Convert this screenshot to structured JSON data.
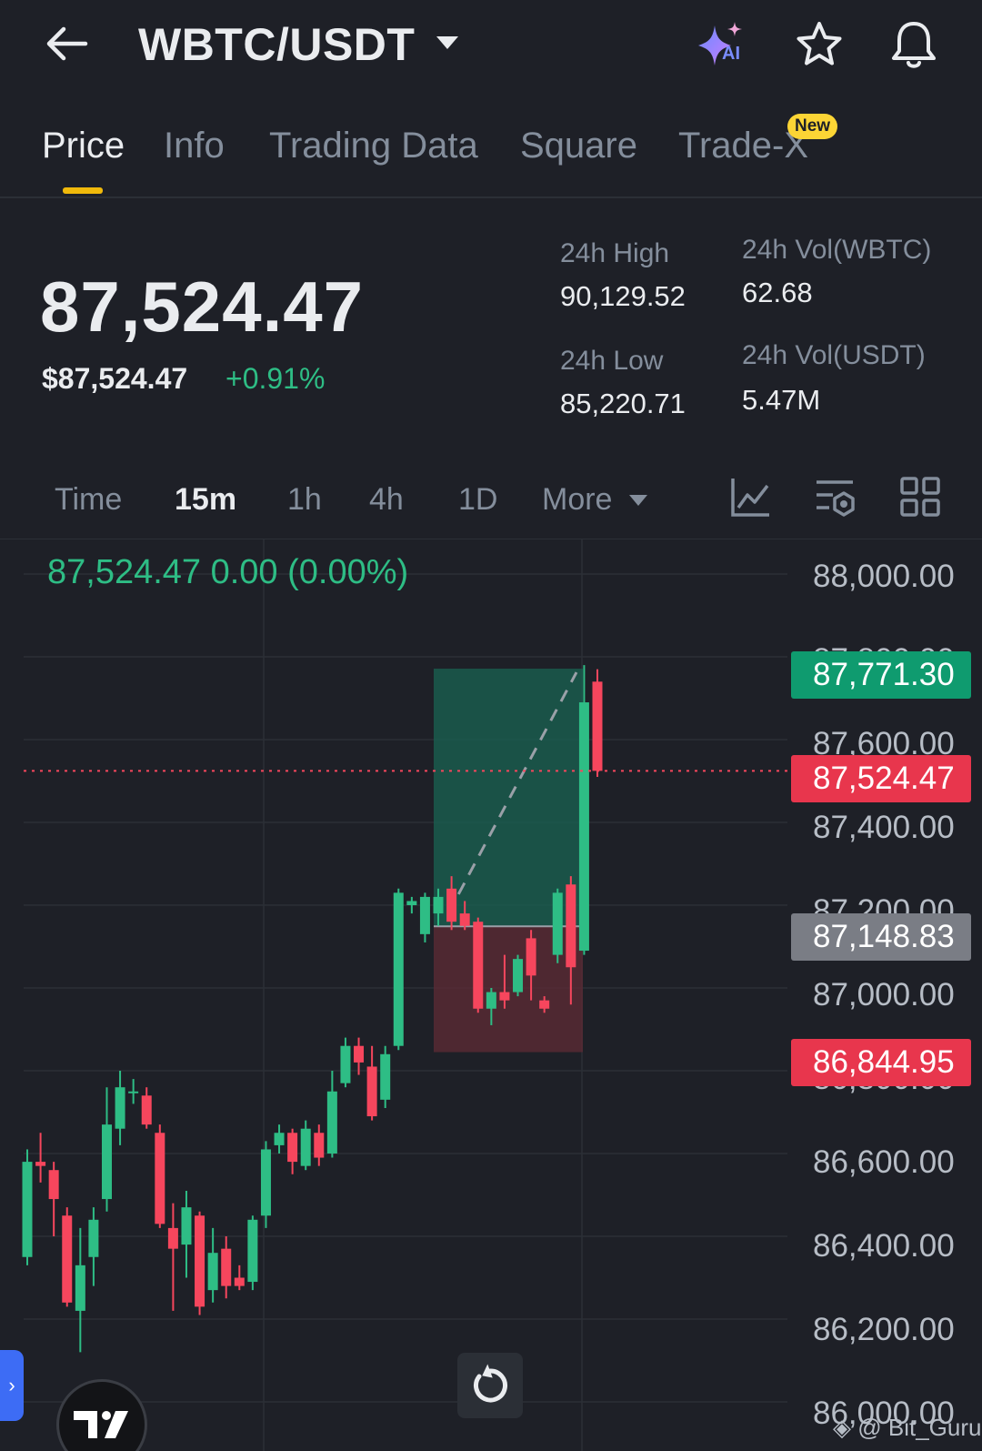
{
  "header": {
    "pair": "WBTC/USDT",
    "icons": [
      "back-arrow-icon",
      "caret-down-icon",
      "ai-sparkle-icon",
      "star-icon",
      "bell-icon"
    ],
    "ai_badge": "AI"
  },
  "tabs": [
    {
      "label": "Price",
      "active": true
    },
    {
      "label": "Info",
      "active": false
    },
    {
      "label": "Trading Data",
      "active": false
    },
    {
      "label": "Square",
      "active": false
    },
    {
      "label": "Trade-X",
      "active": false
    }
  ],
  "new_badge": "New",
  "ticker": {
    "last_price": "87,524.47",
    "usd_price": "$87,524.47",
    "change_pct": "+0.91%",
    "high_label": "24h High",
    "high_value": "90,129.52",
    "low_label": "24h Low",
    "low_value": "85,220.71",
    "vol_base_label": "24h Vol(WBTC)",
    "vol_base_value": "62.68",
    "vol_quote_label": "24h Vol(USDT)",
    "vol_quote_value": "5.47M"
  },
  "intervals": [
    {
      "label": "Time",
      "active": false
    },
    {
      "label": "15m",
      "active": true
    },
    {
      "label": "1h",
      "active": false
    },
    {
      "label": "4h",
      "active": false
    },
    {
      "label": "1D",
      "active": false
    },
    {
      "label": "More",
      "active": false
    }
  ],
  "tool_icons": [
    "indicator-chart-icon",
    "chart-settings-icon",
    "grid-layout-icon"
  ],
  "chart": {
    "ohlc_line": "87,524.47  0.00 (0.00%)",
    "y_axis_labels": [
      "88,000.00",
      "87,800.00",
      "87,600.00",
      "87,400.00",
      "87,200.00",
      "87,000.00",
      "86,800.00",
      "86,600.00",
      "86,400.00",
      "86,200.00",
      "86,000.00"
    ],
    "tag_high": "87,771.30",
    "tag_last": "87,524.47",
    "tag_entry": "87,148.83",
    "tag_stop": "86,844.95",
    "colors": {
      "up": "#2ebd85",
      "down": "#f6465d",
      "tag_green": "#0f9b6f",
      "tag_red": "#e8364d",
      "tag_gray": "#7a7d85"
    }
  },
  "chart_data": {
    "type": "candlestick",
    "interval": "15m",
    "ylim": [
      86000,
      88000
    ],
    "y_ticks": [
      86000,
      86200,
      86400,
      86600,
      86800,
      87000,
      87200,
      87400,
      87600,
      87800,
      88000
    ],
    "candles": [
      {
        "o": 86350,
        "h": 86610,
        "l": 86330,
        "c": 86580
      },
      {
        "o": 86580,
        "h": 86650,
        "l": 86530,
        "c": 86570
      },
      {
        "o": 86560,
        "h": 86580,
        "l": 86400,
        "c": 86490
      },
      {
        "o": 86450,
        "h": 86470,
        "l": 86230,
        "c": 86240
      },
      {
        "o": 86220,
        "h": 86420,
        "l": 86120,
        "c": 86330
      },
      {
        "o": 86350,
        "h": 86470,
        "l": 86280,
        "c": 86440
      },
      {
        "o": 86490,
        "h": 86760,
        "l": 86460,
        "c": 86670
      },
      {
        "o": 86660,
        "h": 86800,
        "l": 86620,
        "c": 86760
      },
      {
        "o": 86750,
        "h": 86780,
        "l": 86720,
        "c": 86750
      },
      {
        "o": 86740,
        "h": 86760,
        "l": 86660,
        "c": 86670
      },
      {
        "o": 86650,
        "h": 86670,
        "l": 86420,
        "c": 86430
      },
      {
        "o": 86420,
        "h": 86480,
        "l": 86220,
        "c": 86370
      },
      {
        "o": 86380,
        "h": 86510,
        "l": 86300,
        "c": 86470
      },
      {
        "o": 86450,
        "h": 86460,
        "l": 86210,
        "c": 86230
      },
      {
        "o": 86270,
        "h": 86420,
        "l": 86240,
        "c": 86360
      },
      {
        "o": 86370,
        "h": 86400,
        "l": 86250,
        "c": 86280
      },
      {
        "o": 86300,
        "h": 86330,
        "l": 86270,
        "c": 86280
      },
      {
        "o": 86290,
        "h": 86450,
        "l": 86270,
        "c": 86440
      },
      {
        "o": 86450,
        "h": 86630,
        "l": 86420,
        "c": 86610
      },
      {
        "o": 86620,
        "h": 86670,
        "l": 86600,
        "c": 86650
      },
      {
        "o": 86650,
        "h": 86660,
        "l": 86550,
        "c": 86580
      },
      {
        "o": 86570,
        "h": 86680,
        "l": 86560,
        "c": 86660
      },
      {
        "o": 86650,
        "h": 86670,
        "l": 86570,
        "c": 86590
      },
      {
        "o": 86600,
        "h": 86800,
        "l": 86590,
        "c": 86750
      },
      {
        "o": 86770,
        "h": 86880,
        "l": 86760,
        "c": 86860
      },
      {
        "o": 86860,
        "h": 86880,
        "l": 86790,
        "c": 86820
      },
      {
        "o": 86810,
        "h": 86860,
        "l": 86680,
        "c": 86690
      },
      {
        "o": 86730,
        "h": 86860,
        "l": 86710,
        "c": 86840
      },
      {
        "o": 86860,
        "h": 87240,
        "l": 86850,
        "c": 87230
      },
      {
        "o": 87200,
        "h": 87220,
        "l": 87180,
        "c": 87210
      },
      {
        "o": 87130,
        "h": 87230,
        "l": 87110,
        "c": 87220
      },
      {
        "o": 87180,
        "h": 87240,
        "l": 87150,
        "c": 87220
      },
      {
        "o": 87240,
        "h": 87270,
        "l": 87140,
        "c": 87160
      },
      {
        "o": 87180,
        "h": 87210,
        "l": 87140,
        "c": 87150
      },
      {
        "o": 87160,
        "h": 87170,
        "l": 86940,
        "c": 86950
      },
      {
        "o": 86950,
        "h": 87000,
        "l": 86910,
        "c": 86990
      },
      {
        "o": 86990,
        "h": 87080,
        "l": 86950,
        "c": 86970
      },
      {
        "o": 86990,
        "h": 87080,
        "l": 86980,
        "c": 87070
      },
      {
        "o": 87120,
        "h": 87140,
        "l": 86970,
        "c": 87030
      },
      {
        "o": 86970,
        "h": 86980,
        "l": 86940,
        "c": 86950
      },
      {
        "o": 87080,
        "h": 87240,
        "l": 87060,
        "c": 87230
      },
      {
        "o": 87250,
        "h": 87270,
        "l": 86960,
        "c": 87050
      },
      {
        "o": 87090,
        "h": 87780,
        "l": 87080,
        "c": 87690
      },
      {
        "o": 87740,
        "h": 87770,
        "l": 87510,
        "c": 87524.47
      }
    ],
    "last_price": 87524.47,
    "tags": {
      "high": 87771.3,
      "last": 87524.47,
      "entry": 87148.83,
      "stop": 86844.95
    },
    "position_box": {
      "entry": 87148.83,
      "target": 87771.3,
      "stop": 86844.95
    }
  }
}
